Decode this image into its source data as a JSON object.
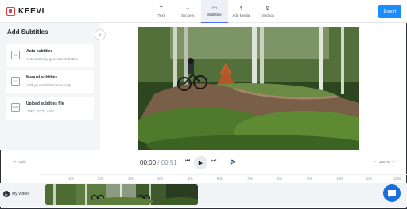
{
  "app": {
    "brand": "KEEVI"
  },
  "nav": [
    {
      "label": "Text",
      "icon": "text-icon",
      "glyph": "T"
    },
    {
      "label": "Stickers",
      "icon": "stickers-icon",
      "glyph": "⁘"
    },
    {
      "label": "Subtitles",
      "icon": "subtitles-icon",
      "glyph": "▭",
      "active": true
    },
    {
      "label": "Add Media",
      "icon": "upload-icon",
      "glyph": "⤒"
    },
    {
      "label": "Settings",
      "icon": "gear-icon",
      "glyph": "⚙"
    }
  ],
  "export_label": "Export",
  "panel": {
    "title": "Add Subtitles",
    "options": [
      {
        "title": "Auto subtitles",
        "desc": "Automatically generate subtitles",
        "icon": "auto-subtitles-icon",
        "glyph": "CC"
      },
      {
        "title": "Manual subtitles",
        "desc": "Add your subtitles manually",
        "icon": "manual-subtitles-icon",
        "glyph": "CC"
      },
      {
        "title": "Upload subtitles file",
        "desc": ".SRT, .VTT, .ASS",
        "icon": "file-icon",
        "glyph": "SRT"
      }
    ]
  },
  "player": {
    "split_label": "Split",
    "current_time": "00:00",
    "separator": " / ",
    "total_time": "00:51",
    "zoom": "100 %"
  },
  "timeline": {
    "ticks": [
      "10s",
      "20s",
      "30s",
      "40s",
      "50s",
      "60s",
      "70s",
      "80s",
      "90s",
      "100s",
      "110s",
      "120s"
    ],
    "track_label": "My Video"
  },
  "colors": {
    "accent": "#1a8cff",
    "brand": "#e43b3b"
  }
}
